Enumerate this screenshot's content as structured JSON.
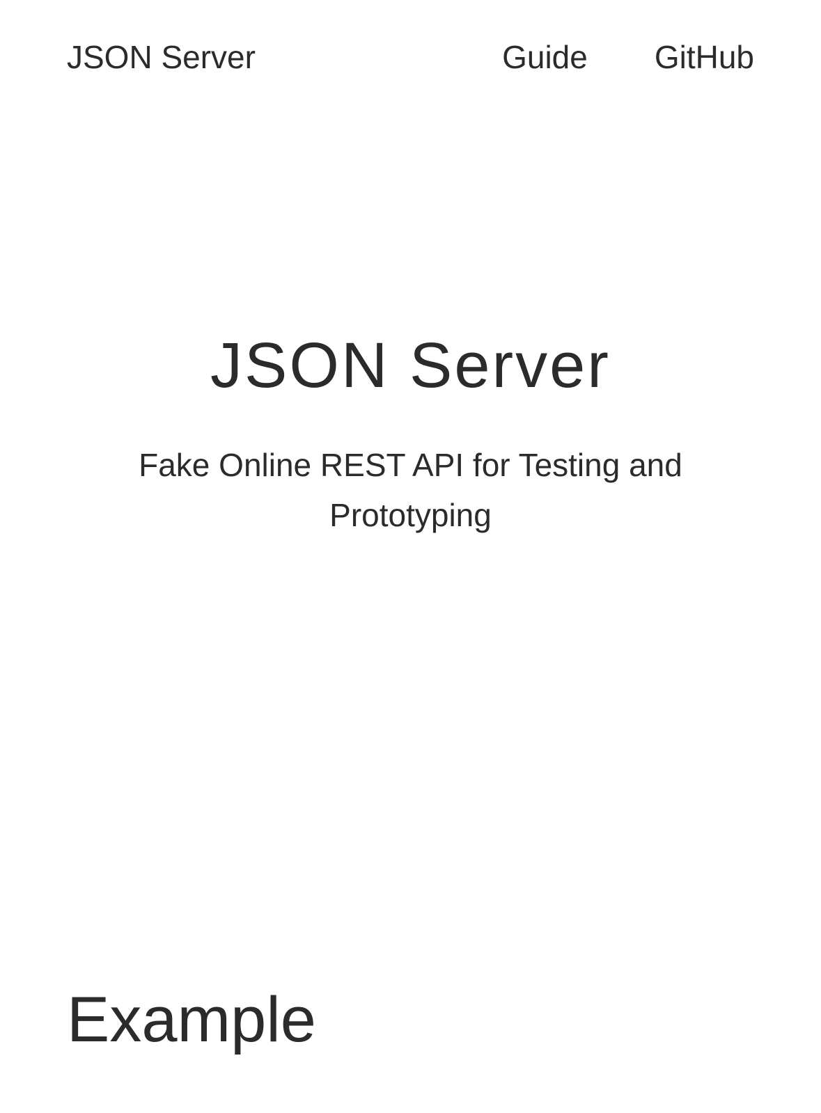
{
  "header": {
    "brand": "JSON Server",
    "nav": [
      {
        "label": "Guide"
      },
      {
        "label": "GitHub"
      }
    ]
  },
  "hero": {
    "title": "JSON Server",
    "subtitle": "Fake Online REST API for Testing and Prototyping"
  },
  "sections": {
    "example_heading": "Example"
  },
  "colors": {
    "text": "#2b2b2b",
    "background": "#ffffff"
  }
}
